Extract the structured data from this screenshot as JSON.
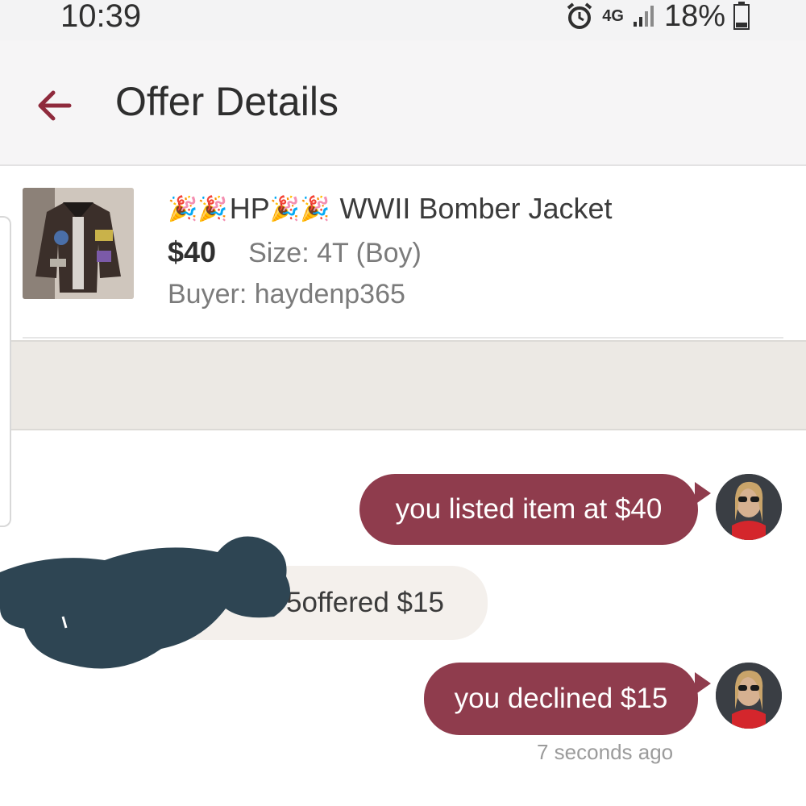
{
  "status_bar": {
    "time": "10:39",
    "network": "4G",
    "battery": "18%"
  },
  "header": {
    "title": "Offer Details",
    "back_icon": "arrow-left-icon"
  },
  "listing": {
    "title_prefix": "🎉🎉",
    "title_hp": "HP",
    "title_emojis_2": "🎉🎉",
    "title_text": "WWII Bomber Jacket",
    "price": "$40",
    "size": "Size: 4T (Boy)",
    "buyer": "Buyer: haydenp365",
    "image": "bomber-jacket-thumbnail"
  },
  "messages": [
    {
      "from": "seller",
      "text": "you listed item at $40"
    },
    {
      "from": "buyer",
      "visible_prefix": "5",
      "text": " offered $15"
    },
    {
      "from": "seller",
      "text": "you declined $15"
    }
  ],
  "timestamp": "7 seconds ago",
  "colors": {
    "accent": "#8f3c4d",
    "back_arrow": "#8f2a3c",
    "incoming_bubble": "#f4f0ec",
    "redaction": "#2e4553"
  }
}
